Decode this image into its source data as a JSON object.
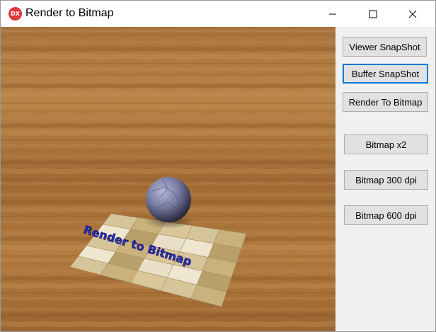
{
  "window": {
    "title": "Render to Bitmap",
    "icon_label": "DX"
  },
  "scene": {
    "floor_text": "Render to Bitmap"
  },
  "panel": {
    "buttons": [
      {
        "label": "Viewer SnapShot"
      },
      {
        "label": "Buffer SnapShot",
        "focused": true
      },
      {
        "label": "Render To Bitmap"
      },
      {
        "label": "Bitmap x2"
      },
      {
        "label": "Bitmap 300 dpi"
      },
      {
        "label": "Bitmap 600 dpi"
      }
    ]
  },
  "colors": {
    "accent": "#0078d7",
    "app_icon": "#e0383e",
    "text_3d": "#2a2ea8"
  }
}
